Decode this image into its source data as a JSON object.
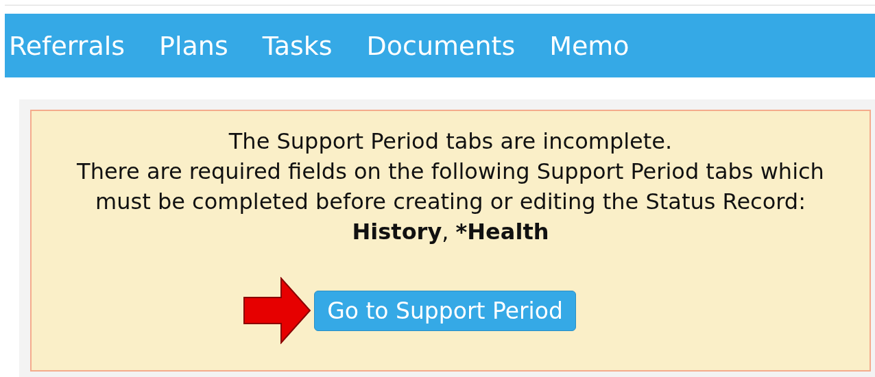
{
  "nav": {
    "items": [
      {
        "label": "Referrals"
      },
      {
        "label": "Plans"
      },
      {
        "label": "Tasks"
      },
      {
        "label": "Documents"
      },
      {
        "label": "Memo"
      }
    ]
  },
  "alert": {
    "title": "The Support Period tabs are incomplete.",
    "message": "There are required fields on the following Support Period tabs which must be completed before creating or editing the Status Record:",
    "tabs": "**History**, ***Health**",
    "button": "Go to Support Period"
  }
}
